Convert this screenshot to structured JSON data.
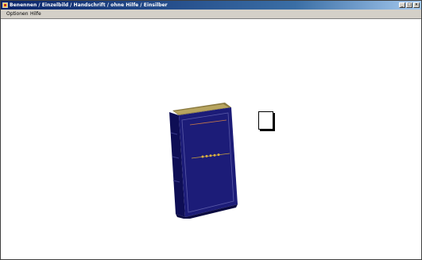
{
  "window": {
    "title": "Benennen / Einzelbild / Handschrift / ohne Hilfe / Einsilber"
  },
  "menu": {
    "items": [
      {
        "label": "Optionen"
      },
      {
        "label": "Hilfe"
      }
    ]
  },
  "content": {
    "book_image": "blue-book-picture",
    "answer_box": "empty-checkbox"
  },
  "colors": {
    "title_bar": "#0a246a",
    "book_cover": "#1c1c78",
    "gold": "#c8a040"
  }
}
